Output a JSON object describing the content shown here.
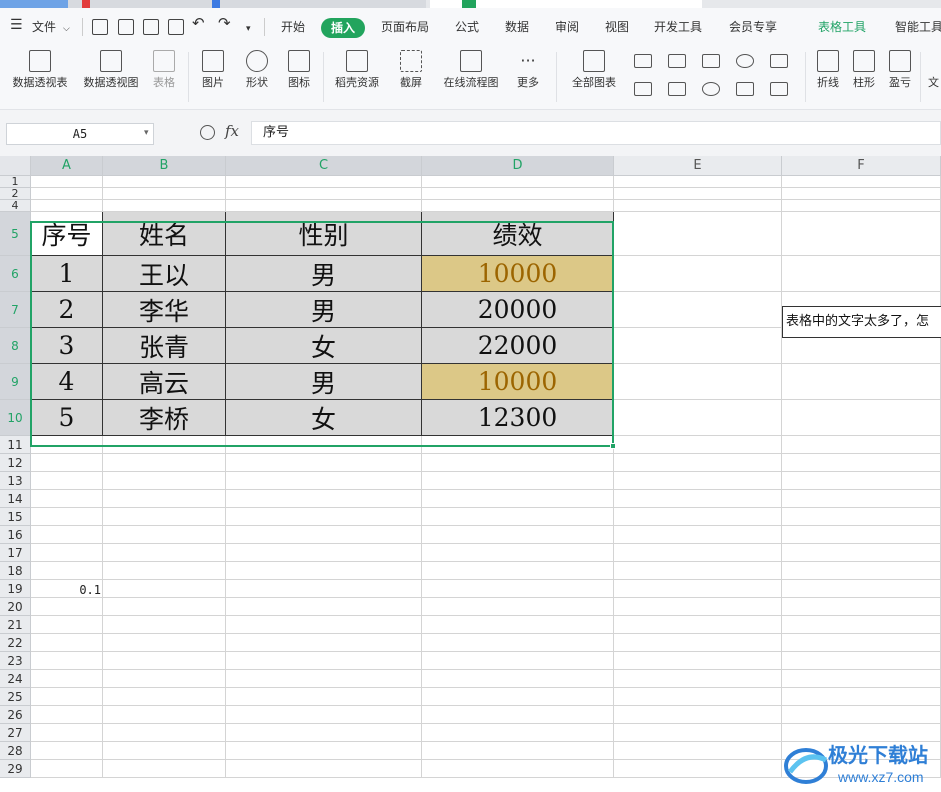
{
  "menu": {
    "file": "文件",
    "tabs": [
      "开始",
      "插入",
      "页面布局",
      "公式",
      "数据",
      "审阅",
      "视图",
      "开发工具",
      "会员专享",
      "表格工具",
      "智能工具"
    ],
    "active": "插入",
    "highlight": "表格工具"
  },
  "ribbon": {
    "pivot_table": "数据透视表",
    "pivot_chart": "数据透视图",
    "table": "表格",
    "picture": "图片",
    "shape": "形状",
    "icon": "图标",
    "docer": "稻壳资源",
    "screenshot": "截屏",
    "flowchart": "在线流程图",
    "more": "更多",
    "all_charts": "全部图表",
    "line": "折线",
    "column": "柱形",
    "winloss": "盈亏",
    "text_cut": "文"
  },
  "formula_bar": {
    "name_box": "A5",
    "fx": "fx",
    "content": "序号"
  },
  "columns": [
    "A",
    "B",
    "C",
    "D",
    "E",
    "F"
  ],
  "rows": [
    "1",
    "2",
    "4",
    "5",
    "6",
    "7",
    "8",
    "9",
    "10",
    "11",
    "12",
    "13",
    "14",
    "15",
    "16",
    "17",
    "18",
    "19",
    "20",
    "21",
    "22",
    "23",
    "24",
    "25",
    "26",
    "27",
    "28",
    "29"
  ],
  "table": {
    "headers": [
      "序号",
      "姓名",
      "性别",
      "绩效"
    ],
    "rows": [
      [
        "1",
        "王以",
        "男",
        "10000"
      ],
      [
        "2",
        "李华",
        "男",
        "20000"
      ],
      [
        "3",
        "张青",
        "女",
        "22000"
      ],
      [
        "4",
        "高云",
        "男",
        "10000"
      ],
      [
        "5",
        "李桥",
        "女",
        "12300"
      ]
    ],
    "highlighted_rows": [
      0,
      3
    ],
    "highlight_color": "#dcc887",
    "highlight_text_color": "#9c6500",
    "cell_bg": "#d9d9d9"
  },
  "note_text": "表格中的文字太多了，怎",
  "cell_a18": "0.1",
  "watermark": {
    "title": "极光下载站",
    "url": "www.xz7.com"
  },
  "colors": {
    "accent": "#21a366",
    "menu_active_bg": "#22a45d"
  }
}
